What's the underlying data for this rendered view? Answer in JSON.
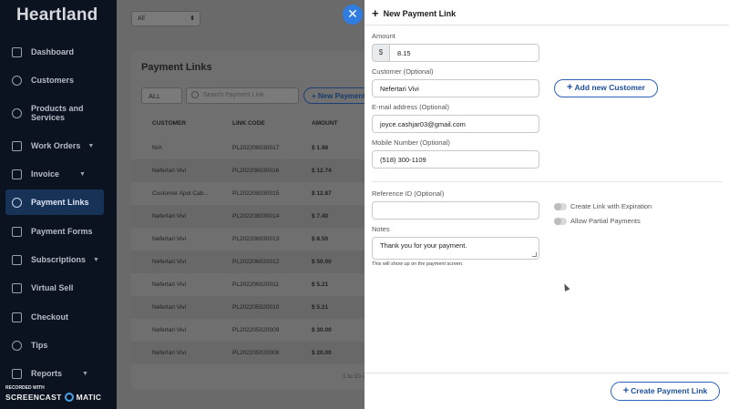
{
  "brand": "Heartland",
  "sidebar": {
    "items": [
      {
        "label": "Dashboard",
        "chevron": false
      },
      {
        "label": "Customers",
        "chevron": false
      },
      {
        "label": "Products and Services",
        "chevron": false
      },
      {
        "label": "Work Orders",
        "chevron": true
      },
      {
        "label": "Invoice",
        "chevron": true
      },
      {
        "label": "Payment Links",
        "chevron": false,
        "active": true
      },
      {
        "label": "Payment Forms",
        "chevron": false
      },
      {
        "label": "Subscriptions",
        "chevron": true
      },
      {
        "label": "Virtual Sell",
        "chevron": false
      },
      {
        "label": "Checkout",
        "chevron": false
      },
      {
        "label": "Tips",
        "chevron": false
      },
      {
        "label": "Reports",
        "chevron": true
      }
    ]
  },
  "watermark": {
    "line1": "RECORDED WITH",
    "left": "SCREENCAST",
    "right": "MATIC"
  },
  "main": {
    "filter_value": "All",
    "title": "Payment Links",
    "all_button": "ALL",
    "search_placeholder": "Search Payment Link",
    "new_button": "+ New Payment Link",
    "columns": [
      "CUSTOMER",
      "LINK CODE",
      "AMOUNT"
    ],
    "rows": [
      {
        "customer": "N/A",
        "code": "PL202208030017",
        "amount": "$ 1.98"
      },
      {
        "customer": "Nefertari Vivi",
        "code": "PL202208030016",
        "amount": "$ 12.74"
      },
      {
        "customer": "Customer Apol Cab...",
        "code": "PL202208030015",
        "amount": "$ 12.87"
      },
      {
        "customer": "Nefertari Vivi",
        "code": "PL202208030014",
        "amount": "$ 7.40"
      },
      {
        "customer": "Nefertari Vivi",
        "code": "PL202208030013",
        "amount": "$ 8.50"
      },
      {
        "customer": "Nefertari Vivi",
        "code": "PL202206020012",
        "amount": "$ 50.00"
      },
      {
        "customer": "Nefertari Vivi",
        "code": "PL202206020011",
        "amount": "$ 5.21"
      },
      {
        "customer": "Nefertari Vivi",
        "code": "PL202205020010",
        "amount": "$ 5.21"
      },
      {
        "customer": "Nefertari Vivi",
        "code": "PL202205020009",
        "amount": "$ 30.00"
      },
      {
        "customer": "Nefertari Vivi",
        "code": "PL202205020008",
        "amount": "$ 20.00"
      }
    ],
    "paging": "1 to 10 o"
  },
  "panel": {
    "title": "New Payment Link",
    "amount_label": "Amount",
    "currency": "$",
    "amount_value": "8.15",
    "customer_label": "Customer (Optional)",
    "customer_value": "Nefertari Vivi",
    "add_customer": "Add new Customer",
    "email_label": "E-mail address (Optional)",
    "email_value": "joyce.cashjar03@gmail.com",
    "mobile_label": "Mobile Number (Optional)",
    "mobile_value": "(518) 300-1109",
    "reference_label": "Reference ID (Optional)",
    "reference_value": "",
    "expiration_toggle": "Create Link with Expiration",
    "partial_toggle": "Allow Partial Payments",
    "notes_label": "Notes",
    "notes_value": "Thank you for your payment.",
    "notes_hint": "This will show up on the payment screen.",
    "create_button": "Create Payment Link"
  },
  "colors": {
    "accent": "#2f7de1",
    "sidebar": "#0b1220",
    "active": "#173257"
  }
}
